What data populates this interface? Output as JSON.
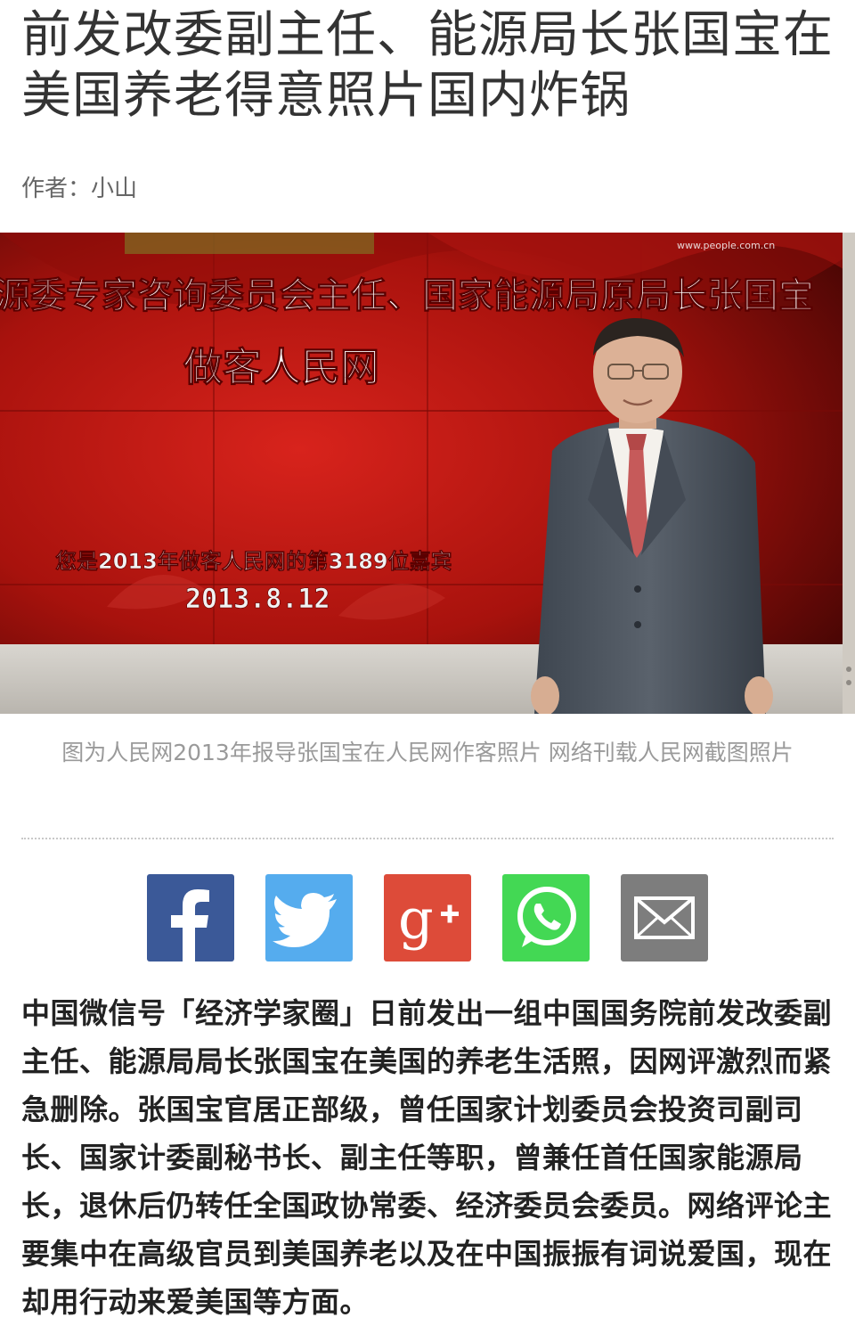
{
  "article": {
    "title": "前发改委副主任、能源局长张国宝在美国养老得意照片国内炸锅",
    "byline": "作者：小山",
    "photo": {
      "banner_line1": "源委专家咨询委员会主任、国家能源局原局长张国宝",
      "banner_line2": "做客人民网",
      "guest_text": "您是2013年做客人民网的第3189位嘉宾",
      "date_text": "2013.8.12",
      "site_url": "www.people.com.cn"
    },
    "caption": "图为人民网2013年报导张国宝在人民网作客照片 网络刊载人民网截图照片",
    "body": "中国微信号「经济学家圈」日前发出一组中国国务院前发改委副主任、能源局局长张国宝在美国的养老生活照，因网评激烈而紧急删除。张国宝官居正部级，曾任国家计划委员会投资司副司长、国家计委副秘书长、副主任等职，曾兼任首任国家能源局长，退休后仍转任全国政协常委、经济委员会委员。网络评论主要集中在高级官员到美国养老以及在中国振振有词说爱国，现在却用行动来爱美国等方面。"
  },
  "share": {
    "buttons": [
      {
        "id": "facebook",
        "icon": "facebook-icon",
        "color": "#3b5998"
      },
      {
        "id": "twitter",
        "icon": "twitter-icon",
        "color": "#55acee"
      },
      {
        "id": "googleplus",
        "icon": "google-plus-icon",
        "color": "#dd4b39"
      },
      {
        "id": "whatsapp",
        "icon": "whatsapp-icon",
        "color": "#43d854"
      },
      {
        "id": "email",
        "icon": "email-icon",
        "color": "#7d7d7d"
      }
    ]
  }
}
